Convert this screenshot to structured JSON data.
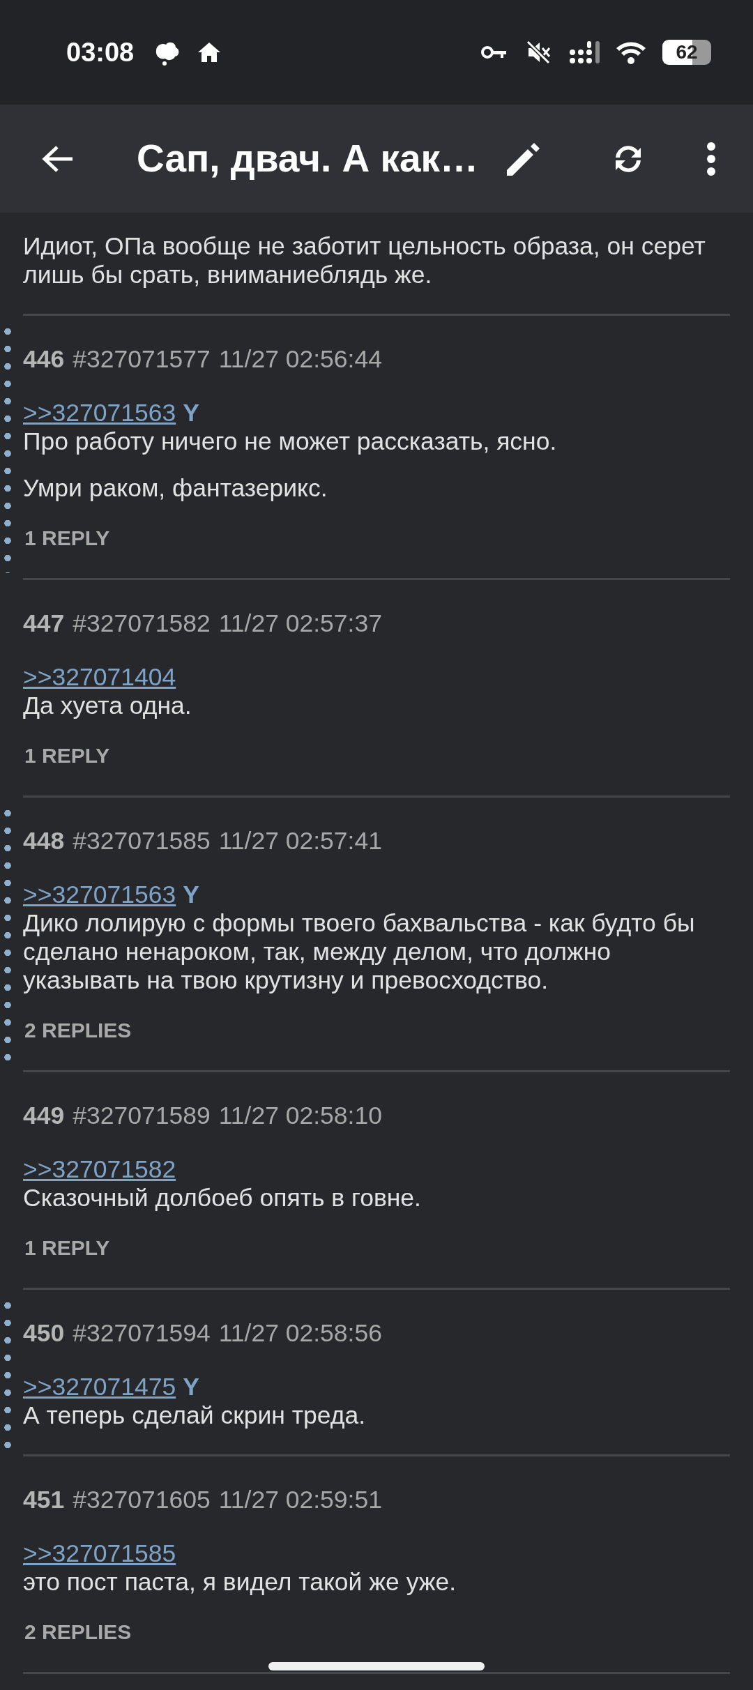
{
  "status_bar": {
    "time": "03:08",
    "battery": "62"
  },
  "toolbar": {
    "title": "Сап, двач. А как…"
  },
  "posts": [
    {
      "highlighted": false,
      "body": [
        "Идиот, ОПа вообще не заботит цельность образа, он серет лишь бы срать, вниманиеблядь же."
      ]
    },
    {
      "highlighted": true,
      "number": "446",
      "id": "#327071577",
      "date": "11/27 02:56:44",
      "quote": ">>327071563",
      "you_mark": "Y",
      "body": [
        "Про работу ничего не может рассказать, ясно.",
        "Умри раком, фантазерикс."
      ],
      "replies": "1 REPLY"
    },
    {
      "highlighted": false,
      "number": "447",
      "id": "#327071582",
      "date": "11/27 02:57:37",
      "quote": ">>327071404",
      "body": [
        "Да хуета одна."
      ],
      "replies": "1 REPLY"
    },
    {
      "highlighted": true,
      "number": "448",
      "id": "#327071585",
      "date": "11/27 02:57:41",
      "quote": ">>327071563",
      "you_mark": "Y",
      "body": [
        "Дико лолирую с формы твоего бахвальства - как будто бы сделано ненароком, так, между делом, что должно указывать на твою крутизну и превосходство."
      ],
      "replies": "2 REPLIES"
    },
    {
      "highlighted": false,
      "number": "449",
      "id": "#327071589",
      "date": "11/27 02:58:10",
      "quote": ">>327071582",
      "body": [
        "Сказочный долбоеб опять в говне."
      ],
      "replies": "1 REPLY"
    },
    {
      "highlighted": true,
      "number": "450",
      "id": "#327071594",
      "date": "11/27 02:58:56",
      "quote": ">>327071475",
      "you_mark": "Y",
      "body": [
        "А теперь сделай скрин треда."
      ]
    },
    {
      "highlighted": false,
      "number": "451",
      "id": "#327071605",
      "date": "11/27 02:59:51",
      "quote": ">>327071585",
      "body": [
        "это пост паста, я видел такой же уже."
      ],
      "replies": "2 REPLIES"
    }
  ]
}
